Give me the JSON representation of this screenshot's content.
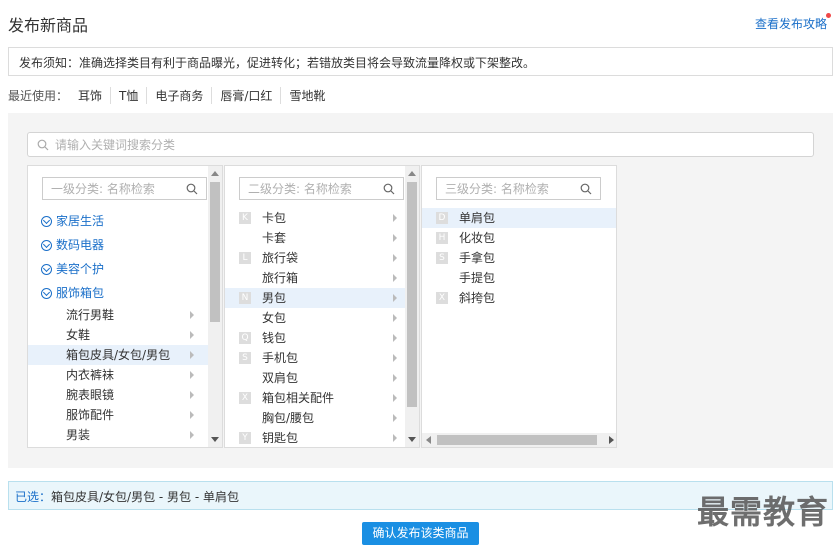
{
  "page": {
    "title": "发布新商品",
    "guide_link": "查看发布攻略"
  },
  "notice": "发布须知：准确选择类目有利于商品曝光，促进转化；若错放类目将会导致流量降权或下架整改。",
  "recent": {
    "label": "最近使用：",
    "items": [
      "耳饰",
      "T恤",
      "电子商务",
      "唇膏/口红",
      "雪地靴"
    ]
  },
  "search": {
    "placeholder": "请输入关键词搜索分类"
  },
  "level1": {
    "placeholder": "一级分类: 名称检索",
    "groups": [
      "家居生活",
      "数码电器",
      "美容个护",
      "服饰箱包"
    ],
    "items": [
      "流行男鞋",
      "女鞋",
      "箱包皮具/女包/男包",
      "内衣裤袜",
      "腕表眼镜",
      "服饰配件",
      "男装"
    ],
    "selected_index": 2
  },
  "level2": {
    "placeholder": "二级分类: 名称检索",
    "items": [
      {
        "letter": "K",
        "label": "卡包"
      },
      {
        "letter": "",
        "label": "卡套"
      },
      {
        "letter": "L",
        "label": "旅行袋"
      },
      {
        "letter": "",
        "label": "旅行箱"
      },
      {
        "letter": "N",
        "label": "男包"
      },
      {
        "letter": "",
        "label": "女包"
      },
      {
        "letter": "Q",
        "label": "钱包"
      },
      {
        "letter": "S",
        "label": "手机包"
      },
      {
        "letter": "",
        "label": "双肩包"
      },
      {
        "letter": "X",
        "label": "箱包相关配件"
      },
      {
        "letter": "",
        "label": "胸包/腰包"
      },
      {
        "letter": "Y",
        "label": "钥匙包"
      }
    ],
    "selected_index": 4
  },
  "level3": {
    "placeholder": "三级分类: 名称检索",
    "items": [
      {
        "letter": "D",
        "label": "单肩包"
      },
      {
        "letter": "H",
        "label": "化妆包"
      },
      {
        "letter": "S",
        "label": "手拿包"
      },
      {
        "letter": "",
        "label": "手提包"
      },
      {
        "letter": "X",
        "label": "斜挎包"
      }
    ],
    "selected_index": 0
  },
  "selected_bar": {
    "label": "已选：",
    "value": "箱包皮具/女包/男包 - 男包 - 单肩包"
  },
  "confirm_button": "确认发布该类商品",
  "watermark": "最需教育"
}
